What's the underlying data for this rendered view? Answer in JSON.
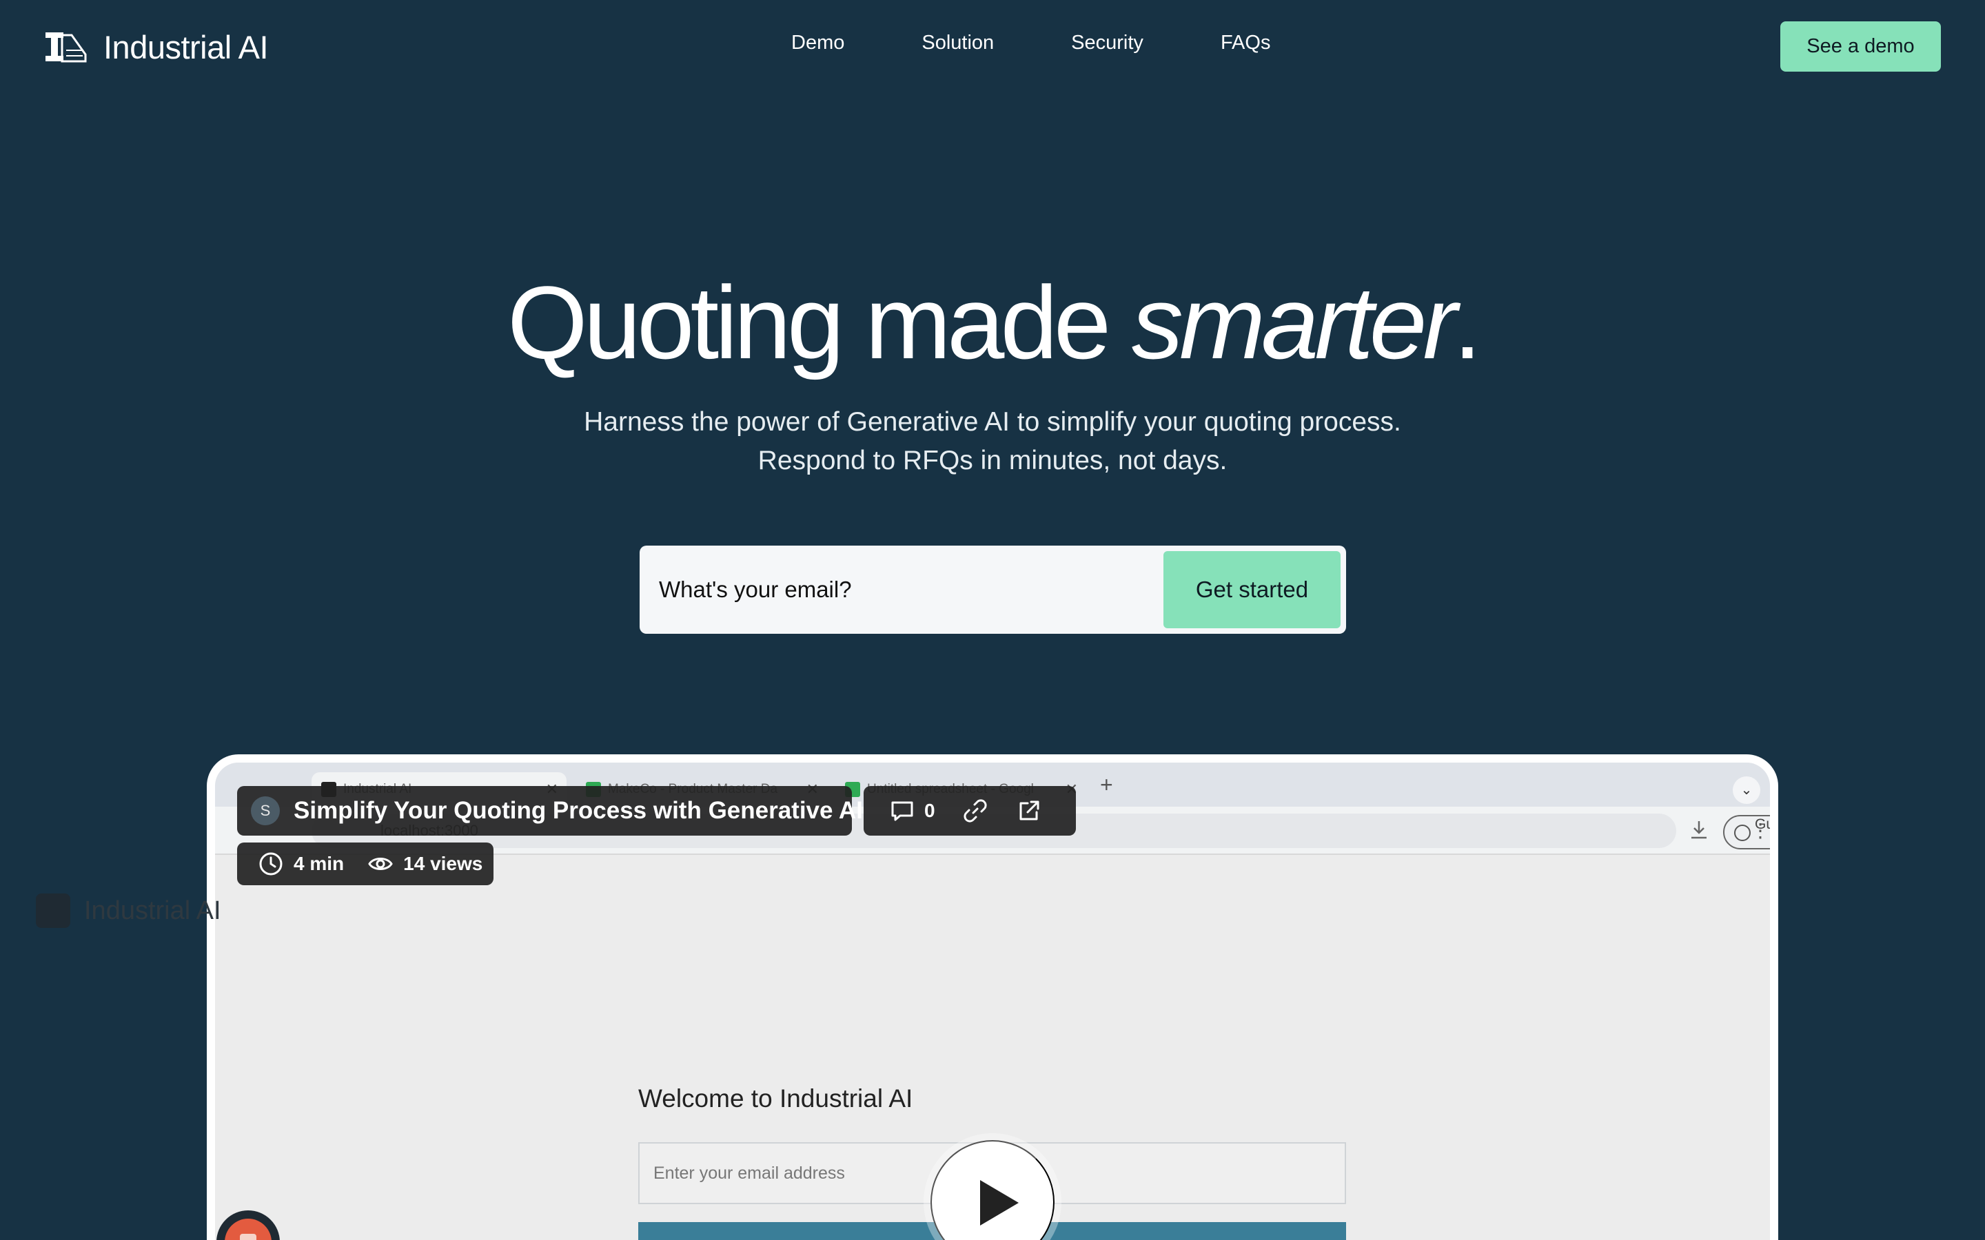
{
  "brand": {
    "name": "Industrial AI"
  },
  "nav": {
    "links": [
      "Demo",
      "Solution",
      "Security",
      "FAQs"
    ],
    "cta": "See a demo"
  },
  "hero": {
    "title_main": "Quoting made ",
    "title_emph": "smarter",
    "title_end": ".",
    "subtitle_line1": "Harness the power of Generative AI to simplify your quoting process.",
    "subtitle_line2": "Respond to RFQs in minutes, not days."
  },
  "signup": {
    "placeholder": "What's your email?",
    "button": "Get started"
  },
  "video": {
    "avatar_initial": "S",
    "title": "Simplify Your Quoting Process with Generative AI",
    "comment_count": "0",
    "duration": "4 min",
    "views": "14 views",
    "browser": {
      "tabs": [
        "Industrial AI",
        "MakeCo - Product Master Da",
        "Untitled spreadsheet - Googl"
      ],
      "url": "localhost:3000",
      "guest_label": "Guest"
    },
    "inner": {
      "brand": "Industrial AI",
      "welcome": "Welcome to Industrial AI",
      "email_placeholder": "Enter your email address"
    }
  },
  "colors": {
    "background": "#173244",
    "accent": "#86e1b9",
    "input_bg": "#f5f7f9"
  },
  "icons": [
    "logo-icon",
    "comment-icon",
    "link-icon",
    "external-link-icon",
    "clock-icon",
    "eye-icon",
    "play-icon",
    "download-icon",
    "guest-icon"
  ]
}
